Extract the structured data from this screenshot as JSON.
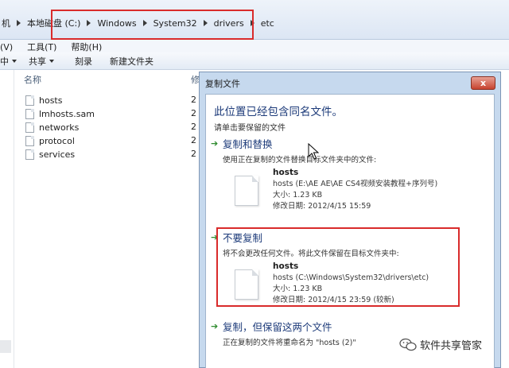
{
  "address": {
    "crumbs": [
      "机",
      "本地磁盘 (C:)",
      "Windows",
      "System32",
      "drivers",
      "etc"
    ]
  },
  "menu": [
    "(V)",
    "工具(T)",
    "帮助(H)"
  ],
  "toolbar": {
    "items": [
      {
        "label": "中",
        "dropdown": true
      },
      {
        "label": "共享",
        "dropdown": true
      },
      {
        "label": "刻录",
        "dropdown": false
      },
      {
        "label": "新建文件夹",
        "dropdown": false
      }
    ]
  },
  "files": {
    "header_name": "名称",
    "header_date": "修",
    "items": [
      {
        "name": "hosts",
        "date": "2"
      },
      {
        "name": "lmhosts.sam",
        "date": "2"
      },
      {
        "name": "networks",
        "date": "2"
      },
      {
        "name": "protocol",
        "date": "2"
      },
      {
        "name": "services",
        "date": "2"
      }
    ]
  },
  "dialog": {
    "title": "复制文件",
    "close": "x",
    "heading": "此位置已经包含同名文件。",
    "subheading": "请单击要保留的文件",
    "options": [
      {
        "title": "复制和替换",
        "desc": "使用正在复制的文件替换目标文件夹中的文件:",
        "file_name": "hosts",
        "file_path": "hosts (E:\\AE AE\\AE CS4视频安装教程+序列号)",
        "file_size": "大小: 1.23 KB",
        "file_date": "修改日期: 2012/4/15 15:59"
      },
      {
        "title": "不要复制",
        "desc": "将不会更改任何文件。将此文件保留在目标文件夹中:",
        "file_name": "hosts",
        "file_path": "hosts (C:\\Windows\\System32\\drivers\\etc)",
        "file_size": "大小: 1.23 KB",
        "file_date": "修改日期: 2012/4/15 23:59 (较新)"
      },
      {
        "title": "复制，但保留这两个文件",
        "desc": "正在复制的文件将重命名为 \"hosts (2)\""
      }
    ]
  },
  "watermark": "软件共享管家",
  "colors": {
    "highlight_red": "#d92b2b",
    "link_blue": "#1d3b7a",
    "arrow_green": "#2e8b2e"
  }
}
